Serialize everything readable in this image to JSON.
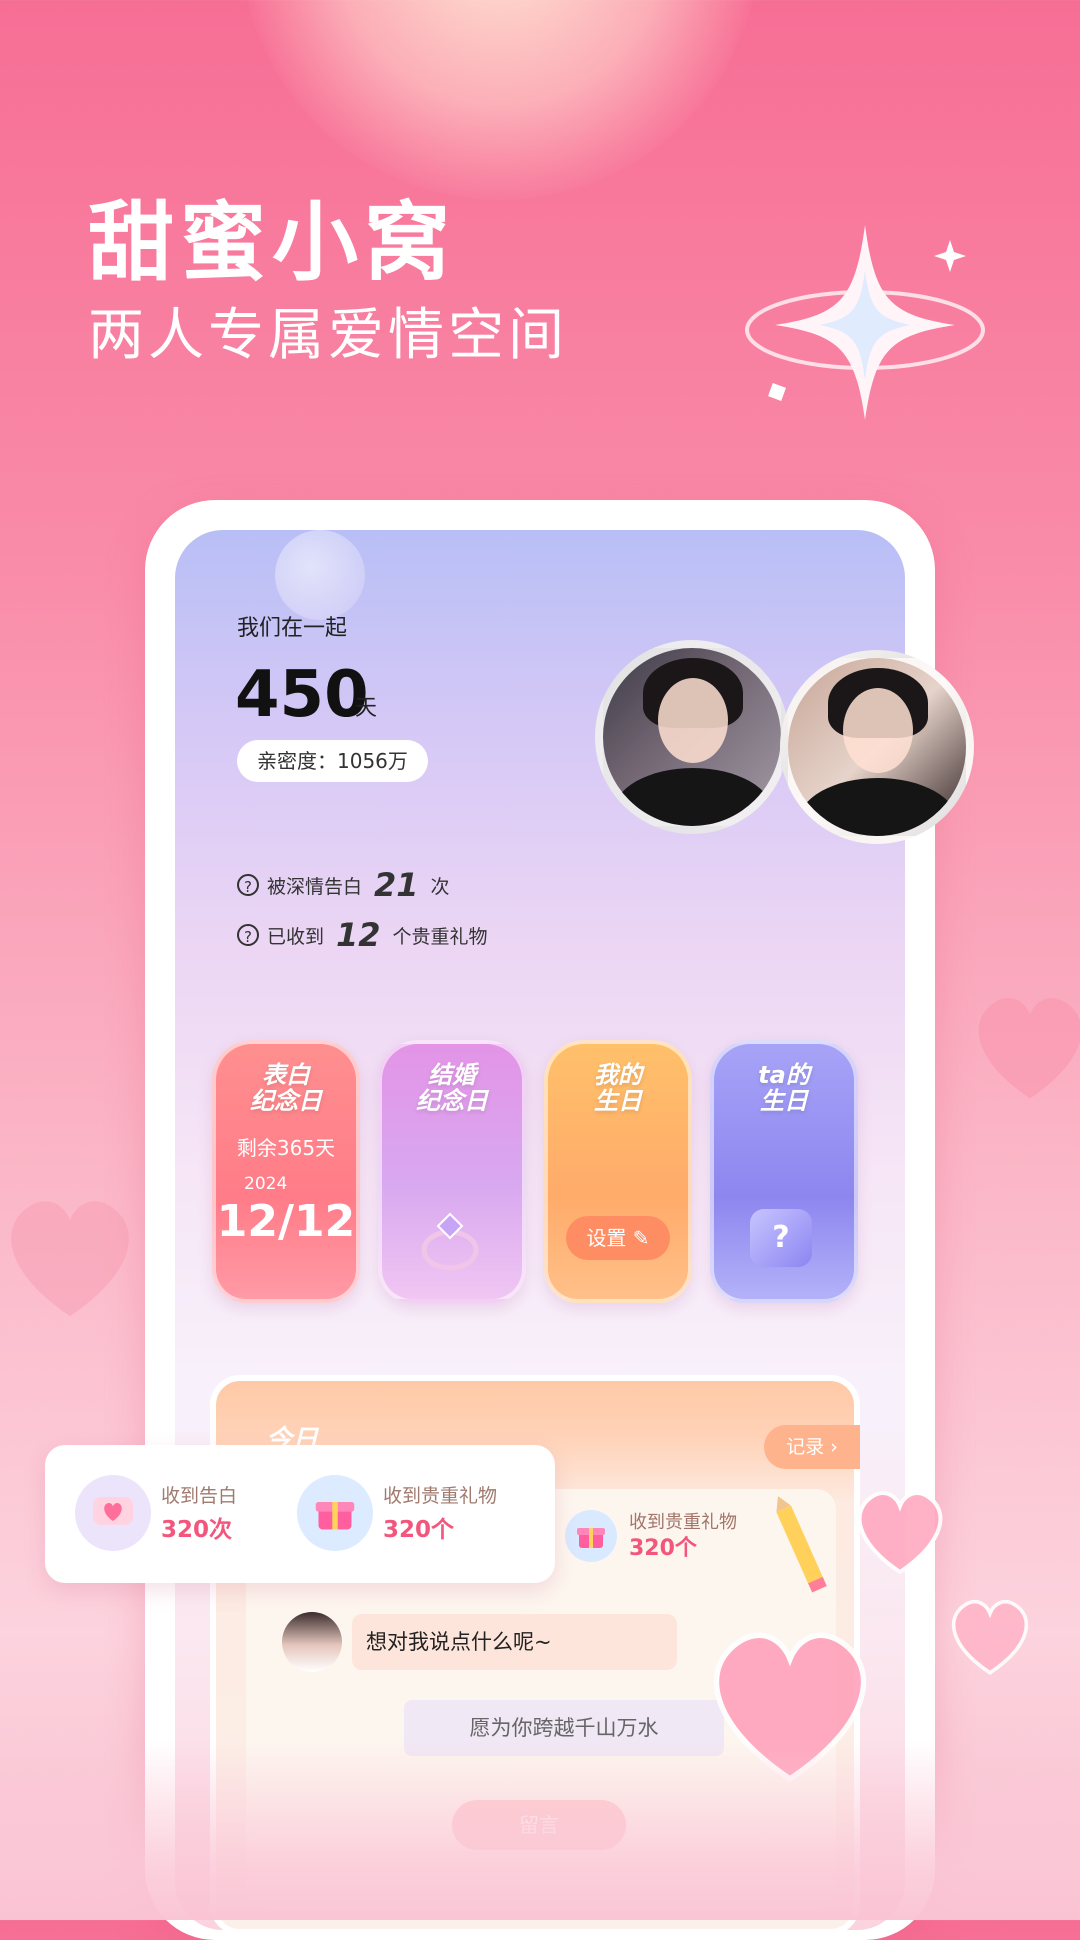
{
  "hero": {
    "title": "甜蜜小窝",
    "subtitle": "两人专属爱情空间"
  },
  "couple": {
    "together_label": "我们在一起",
    "days": "450",
    "days_unit": "天",
    "intimacy": "亲密度：1056万"
  },
  "stats": [
    {
      "label": "被深情告白",
      "value": "21",
      "unit": "次"
    },
    {
      "label": "已收到",
      "value": "12",
      "unit": "个贵重礼物"
    }
  ],
  "cards": [
    {
      "title_a": "表白",
      "title_b": "纪念日",
      "remain": "剩余365天",
      "year": "2024",
      "date": "12/12"
    },
    {
      "title_a": "结婚",
      "title_b": "纪念日"
    },
    {
      "title_a": "我的",
      "title_b": "生日",
      "button": "设置"
    },
    {
      "title_a": "ta的",
      "title_b": "生日",
      "icon_text": "?"
    }
  ],
  "today": {
    "title": "今日",
    "record_button": "记录",
    "gift_label": "收到贵重礼物",
    "gift_count": "320个",
    "prompt": "想对我说点什么呢~",
    "wish": "愿为你跨越千山万水",
    "leave_button": "留言"
  },
  "summary": {
    "confess_label": "收到告白",
    "confess_count": "320次",
    "gift_label": "收到贵重礼物",
    "gift_count": "320个"
  },
  "colors": {
    "accent": "#f2567d",
    "brand_pink": "#f76e95"
  }
}
